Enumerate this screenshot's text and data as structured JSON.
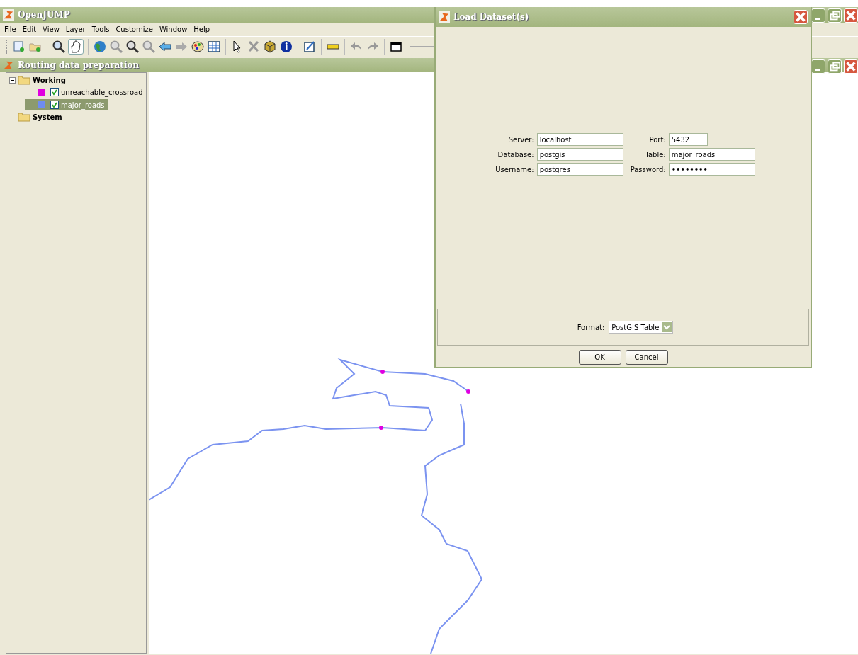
{
  "window": {
    "title": "OpenJUMP"
  },
  "menu": [
    "File",
    "Edit",
    "View",
    "Layer",
    "Tools",
    "Customize",
    "Window",
    "Help"
  ],
  "task_frame": {
    "title": "Routing data preparation"
  },
  "layer_tree": [
    {
      "name": "Working",
      "expanded": true,
      "children": [
        {
          "name": "unreachable_crossroad",
          "color": "#e000e0",
          "checked": true,
          "selected": false
        },
        {
          "name": "major_roads",
          "color": "#6e8cf0",
          "checked": true,
          "selected": true
        }
      ]
    },
    {
      "name": "System"
    }
  ],
  "dialog": {
    "title": "Load Dataset(s)",
    "fields": [
      {
        "label": "Server:",
        "value": "localhost",
        "kind": "text"
      },
      {
        "label": "Port:",
        "value": "5432",
        "kind": "short"
      },
      {
        "label": "Database:",
        "value": "postgis",
        "kind": "text"
      },
      {
        "label": "Table:",
        "value": "major_roads",
        "kind": "text"
      },
      {
        "label": "Username:",
        "value": "postgres",
        "kind": "text"
      },
      {
        "label": "Password:",
        "value": "••••••••",
        "kind": "password"
      }
    ],
    "format": {
      "label": "Format:",
      "value": "PostGIS Table"
    },
    "buttons": [
      "OK",
      "Cancel"
    ]
  }
}
